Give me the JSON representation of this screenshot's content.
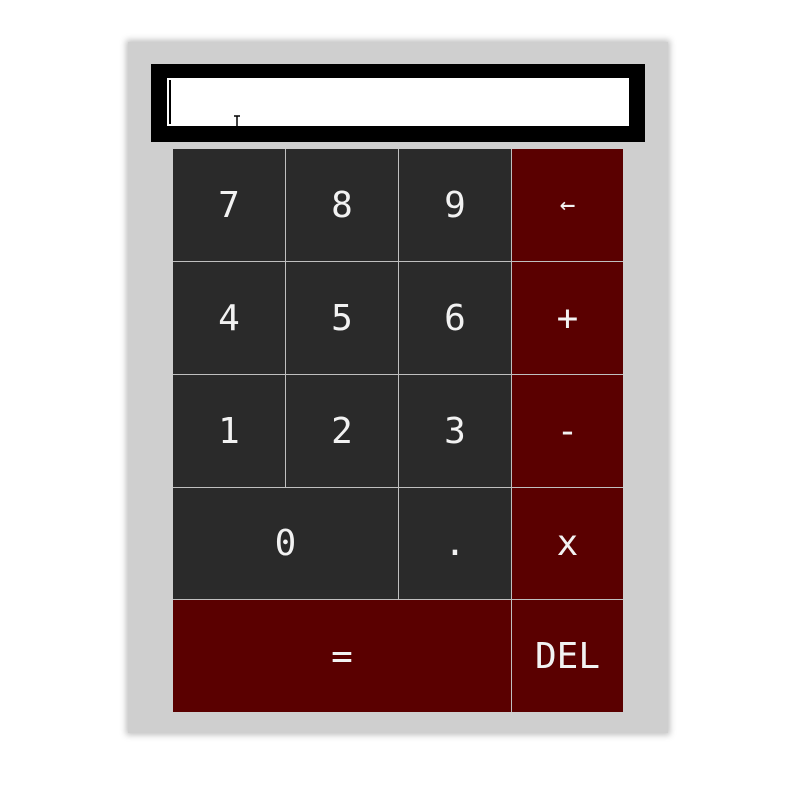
{
  "display": {
    "value": "",
    "placeholder": ""
  },
  "colors": {
    "body": "#cfcfcf",
    "display_frame": "#000000",
    "number_key": "#2a2a2a",
    "operator_key": "#5a0000",
    "key_text": "#f2f2f2"
  },
  "keys": {
    "seven": "7",
    "eight": "8",
    "nine": "9",
    "backspace": "←",
    "four": "4",
    "five": "5",
    "six": "6",
    "plus": "+",
    "one": "1",
    "two": "2",
    "three": "3",
    "minus": "-",
    "zero": "0",
    "decimal": ".",
    "multiply": "x",
    "equals": "=",
    "delete": "DEL"
  }
}
